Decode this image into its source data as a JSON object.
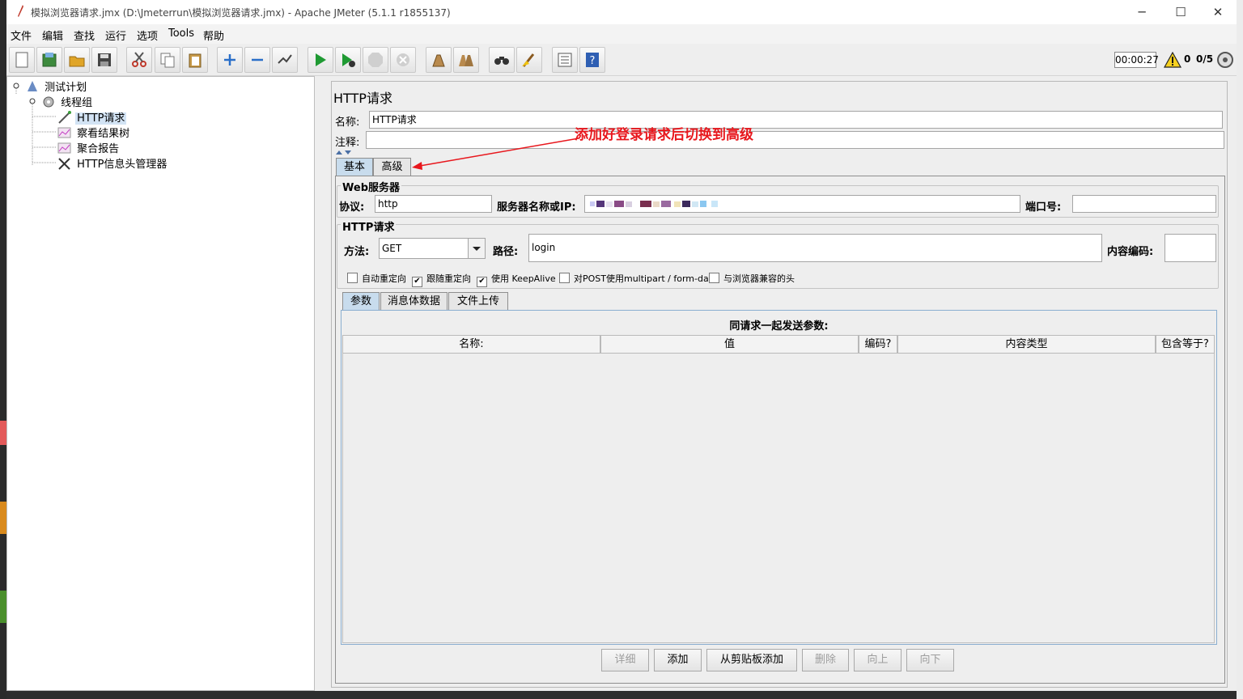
{
  "window": {
    "title": "模拟浏览器请求.jmx (D:\\Jmeterrun\\模拟浏览器请求.jmx) - Apache JMeter (5.1.1 r1855137)",
    "minimize": "─",
    "maximize": "☐",
    "close": "✕"
  },
  "menu": [
    "文件",
    "编辑",
    "查找",
    "运行",
    "选项",
    "Tools",
    "帮助"
  ],
  "toolbar": {
    "icons": [
      "new-icon",
      "templates-icon",
      "open-icon",
      "save-icon",
      "cut-icon",
      "copy-icon",
      "paste-icon",
      "expand-icon",
      "collapse-icon",
      "toggle-icon",
      "start-icon",
      "start-no-pause-icon",
      "stop-icon",
      "shutdown-icon",
      "clear-icon",
      "clear-all-icon",
      "search-icon",
      "reset-search-icon",
      "function-helper-icon",
      "help-icon"
    ],
    "timer": "00:00:27",
    "warning_count": "0",
    "threads": "0/5"
  },
  "tree": {
    "items": [
      {
        "label": "测试计划",
        "icon": "test-plan-icon"
      },
      {
        "label": "线程组",
        "icon": "thread-group-icon"
      },
      {
        "label": "HTTP请求",
        "icon": "sampler-icon"
      },
      {
        "label": "察看结果树",
        "icon": "listener-icon"
      },
      {
        "label": "聚合报告",
        "icon": "listener-icon"
      },
      {
        "label": "HTTP信息头管理器",
        "icon": "config-icon"
      }
    ]
  },
  "panel": {
    "title": "HTTP请求",
    "name_label": "名称:",
    "name_value": "HTTP请求",
    "comment_label": "注释:",
    "comment_value": "",
    "annotation": "添加好登录请求后切换到高级",
    "tabs": [
      "基本",
      "高级"
    ],
    "web_server": {
      "title": "Web服务器",
      "protocol_label": "协议:",
      "protocol_value": "http",
      "server_label": "服务器名称或IP:",
      "port_label": "端口号:",
      "port_value": ""
    },
    "http_request": {
      "title": "HTTP请求",
      "method_label": "方法:",
      "method_value": "GET",
      "path_label": "路径:",
      "path_value": "login",
      "encoding_label": "内容编码:",
      "encoding_value": ""
    },
    "checkboxes": [
      {
        "label": "自动重定向",
        "checked": false
      },
      {
        "label": "跟随重定向",
        "checked": true
      },
      {
        "label": "使用 KeepAlive",
        "checked": true
      },
      {
        "label": "对POST使用multipart / form-data",
        "checked": false
      },
      {
        "label": "与浏览器兼容的头",
        "checked": false
      }
    ],
    "sub_tabs": [
      "参数",
      "消息体数据",
      "文件上传"
    ],
    "params_title": "同请求一起发送参数:",
    "columns": [
      "名称:",
      "值",
      "编码?",
      "内容类型",
      "包含等于?"
    ],
    "buttons": [
      "详细",
      "添加",
      "从剪贴板添加",
      "删除",
      "向上",
      "向下"
    ]
  },
  "colors": {
    "annotation": "#e8171d",
    "selected_tab": "#c8dced",
    "tree_selection": "#d2e3f4"
  }
}
